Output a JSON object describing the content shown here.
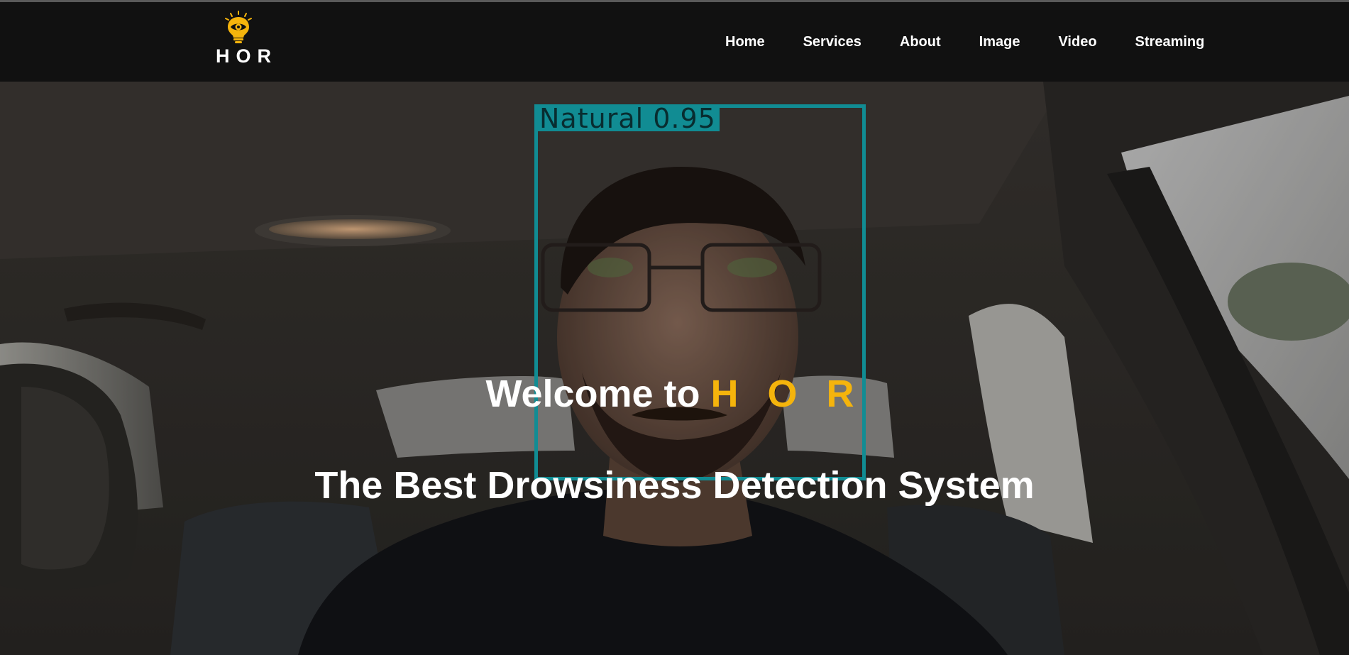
{
  "header": {
    "logo_text": "HOR",
    "nav": {
      "home": "Home",
      "services": "Services",
      "about": "About",
      "image": "Image",
      "video": "Video",
      "streaming": "Streaming"
    }
  },
  "hero": {
    "detection_label": "Natural 0.95",
    "welcome_prefix": "Welcome to ",
    "welcome_brand": "H O R",
    "subtitle": "The Best Drowsiness Detection System"
  },
  "colors": {
    "background": "#111111",
    "brand_accent": "#f5b40c",
    "detection_box": "#118c93",
    "text": "#ffffff"
  },
  "icons": {
    "logo": "lightbulb-eye-icon"
  }
}
